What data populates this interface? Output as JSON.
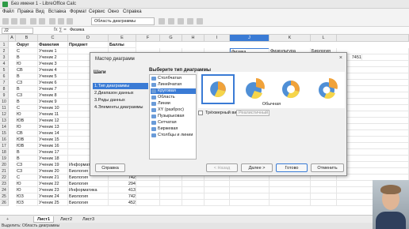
{
  "window": {
    "title": "Без имени 1 - LibreOffice Calc"
  },
  "menu": [
    "Файл",
    "Правка",
    "Вид",
    "Вставка",
    "Формат",
    "Сервис",
    "Окно",
    "Справка"
  ],
  "toolbar": {
    "namebox": "Область диаграммы"
  },
  "formula_bar": {
    "cell_ref": "J2",
    "fx": "fx ∑ =",
    "content": "Физика"
  },
  "columns": [
    "A",
    "B",
    "C",
    "D",
    "E",
    "F",
    "G",
    "H",
    "I",
    "J",
    "K",
    "L"
  ],
  "header_row": {
    "b": "Округ",
    "c": "Фамилия",
    "d": "Предмет",
    "e": "Баллы"
  },
  "rows": [
    {
      "n": "2",
      "b": "С",
      "c": "Ученик 1",
      "d": "",
      "e": ""
    },
    {
      "n": "3",
      "b": "В",
      "c": "Ученик 2",
      "d": "",
      "e": ""
    },
    {
      "n": "4",
      "b": "Ю",
      "c": "Ученик 3",
      "d": "",
      "e": ""
    },
    {
      "n": "5",
      "b": "СВ",
      "c": "Ученик 4",
      "d": "",
      "e": ""
    },
    {
      "n": "6",
      "b": "В",
      "c": "Ученик 5",
      "d": "",
      "e": ""
    },
    {
      "n": "7",
      "b": "С3",
      "c": "Ученик 6",
      "d": "",
      "e": ""
    },
    {
      "n": "8",
      "b": "В",
      "c": "Ученик 7",
      "d": "",
      "e": ""
    },
    {
      "n": "9",
      "b": "С3",
      "c": "Ученик 8",
      "d": "",
      "e": ""
    },
    {
      "n": "10",
      "b": "В",
      "c": "Ученик 9",
      "d": "",
      "e": ""
    },
    {
      "n": "11",
      "b": "С",
      "c": "Ученик 10",
      "d": "",
      "e": ""
    },
    {
      "n": "12",
      "b": "Ю",
      "c": "Ученик 11",
      "d": "",
      "e": ""
    },
    {
      "n": "13",
      "b": "ЮВ",
      "c": "Ученик 12",
      "d": "",
      "e": ""
    },
    {
      "n": "14",
      "b": "Ю",
      "c": "Ученик 13",
      "d": "",
      "e": ""
    },
    {
      "n": "15",
      "b": "СВ",
      "c": "Ученик 14",
      "d": "",
      "e": ""
    },
    {
      "n": "16",
      "b": "ЮВ",
      "c": "Ученик 15",
      "d": "",
      "e": ""
    },
    {
      "n": "17",
      "b": "ЮВ",
      "c": "Ученик 16",
      "d": "",
      "e": ""
    },
    {
      "n": "18",
      "b": "В",
      "c": "Ученик 17",
      "d": "",
      "e": ""
    },
    {
      "n": "19",
      "b": "В",
      "c": "Ученик 18",
      "d": "",
      "e": ""
    },
    {
      "n": "20",
      "b": "С3",
      "c": "Ученик 19",
      "d": "Информатика",
      "e": "184"
    },
    {
      "n": "21",
      "b": "С3",
      "c": "Ученик 20",
      "d": "Биология",
      "e": "194"
    },
    {
      "n": "22",
      "b": "С",
      "c": "Ученик 21",
      "d": "Биология",
      "e": "742"
    },
    {
      "n": "23",
      "b": "Ю",
      "c": "Ученик 22",
      "d": "Биология",
      "e": "294"
    },
    {
      "n": "24",
      "b": "Ю",
      "c": "Ученик 23",
      "d": "Информатика",
      "e": "413"
    },
    {
      "n": "25",
      "b": "ЮЗ",
      "c": "Ученик 24",
      "d": "Биология",
      "e": "742"
    },
    {
      "n": "26",
      "b": "ЮЗ",
      "c": "Ученик 25",
      "d": "Биология",
      "e": "452"
    }
  ],
  "right_header": {
    "j": "Физика",
    "k": "Физкультура",
    "l": "Биология"
  },
  "right_value": "7451",
  "dialog": {
    "title": "Мастер диаграмм",
    "close": "×",
    "steps_title": "Шаги",
    "steps": [
      "1.Тип диаграммы",
      "2.Диапазон данных",
      "3.Ряды данных",
      "4.Элементы диаграммы"
    ],
    "type_title": "Выберите тип диаграммы",
    "types": [
      "Столбчатая",
      "Линейчатая",
      "Круговая",
      "Область",
      "Линии",
      "XY (разброс)",
      "Пузырьковая",
      "Сетчатая",
      "Биржевая",
      "Столбцы и линии"
    ],
    "selected_type": "Круговая",
    "variant_caption": "Обычная",
    "three_d_label": "Трёхмерный вид",
    "three_d_combo": "Реалистичный",
    "buttons": {
      "help": "Справка",
      "back": "< Назад",
      "next": "Далее >",
      "finish": "Готово",
      "cancel": "Отменить"
    }
  },
  "sheet_tabs": [
    "Лист1",
    "Лист2",
    "Лист3"
  ],
  "status": "Выделить: Область диаграммы",
  "colors": {
    "accent": "#3a7bd5",
    "pie_blue": "#4f8fd6",
    "pie_orange": "#f0a23a",
    "pie_yellow": "#f6d54a"
  }
}
